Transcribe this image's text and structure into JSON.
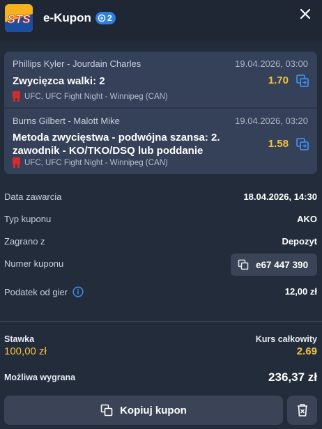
{
  "header": {
    "logo_text": "STS",
    "title": "e-Kupon",
    "badge_count": "2",
    "icons": {
      "badge": "ticket-icon",
      "close": "close-icon"
    }
  },
  "bets": [
    {
      "teams": "Phillips Kyler - Jourdain Charles",
      "date": "19.04.2026, 03:00",
      "pick": "Zwycięzca walki: 2",
      "odds": "1.70",
      "league": "UFC, UFC Fight Night - Winnipeg (CAN)"
    },
    {
      "teams": "Burns Gilbert - Malott Mike",
      "date": "19.04.2026, 03:20",
      "pick": "Metoda zwycięstwa - podwójna szansa: 2. zawodnik - KO/TKO/DSQ lub poddanie",
      "odds": "1.58",
      "league": "UFC, UFC Fight Night - Winnipeg (CAN)"
    }
  ],
  "details": {
    "date_label": "Data zawarcia",
    "date_value": "18.04.2026, 14:30",
    "type_label": "Typ kuponu",
    "type_value": "AKO",
    "played_label": "Zagrano z",
    "played_value": "Depozyt",
    "number_label": "Numer kuponu",
    "number_value": "e67 447 390",
    "tax_label": "Podatek od gier",
    "tax_value": "12,00 zł"
  },
  "summary": {
    "stake_label": "Stawka",
    "stake_value": "100,00 zł",
    "total_odds_label": "Kurs całkowity",
    "total_odds_value": "2.69",
    "win_label": "Możliwa wygrana",
    "win_value": "236,37 zł"
  },
  "footer": {
    "copy_label": "Kopiuj kupon"
  },
  "colors": {
    "background": "#232c3b",
    "header": "#1f2735",
    "card": "#354059",
    "accent_yellow": "#f2c33d",
    "accent_blue": "#2f7fe0",
    "button": "#3b4456"
  }
}
